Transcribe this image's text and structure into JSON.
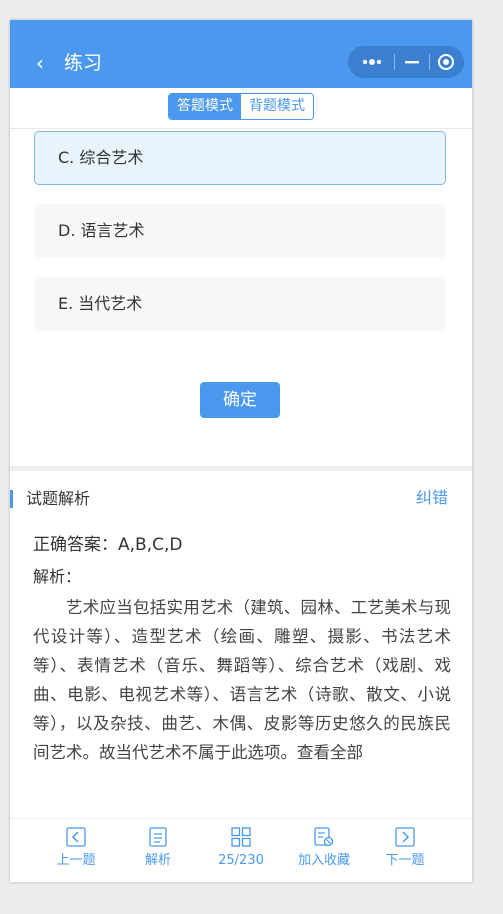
{
  "header": {
    "back_icon": "‹",
    "title": "练习"
  },
  "modes": {
    "answer_mode": "答题模式",
    "memorize_mode": "背题模式"
  },
  "options": [
    {
      "text": "C. 综合艺术",
      "selected": true
    },
    {
      "text": "D. 语言艺术",
      "selected": false
    },
    {
      "text": "E. 当代艺术",
      "selected": false
    }
  ],
  "confirm_label": "确定",
  "analysis": {
    "title": "试题解析",
    "report_label": "纠错",
    "correct_answer": "正确答案：A,B,C,D",
    "label": "解析：",
    "text": "艺术应当包括实用艺术（建筑、园林、工艺美术与现代设计等）、造型艺术（绘画、雕塑、摄影、书法艺术等）、表情艺术（音乐、舞蹈等）、综合艺术（戏剧、戏曲、电影、电视艺术等）、语言艺术（诗歌、散文、小说等），以及杂技、曲艺、木偶、皮影等历史悠久的民族民间艺术。故当代艺术不属于此选项。查看全部"
  },
  "footer": {
    "prev": "上一题",
    "analysis": "解析",
    "progress": "25/230",
    "favorite": "加入收藏",
    "next": "下一题"
  },
  "colors": {
    "accent": "#4a99ee",
    "selected_bg": "#e8f3fc"
  }
}
